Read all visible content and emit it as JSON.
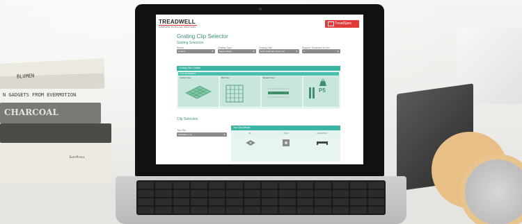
{
  "scene": {
    "book_spine_texts": [
      "BLUMEN",
      "N GADGETS FROM EVERMOTION",
      "CHARCOAL",
      "EverPress"
    ]
  },
  "app": {
    "logo": "TREADWELL",
    "tagline": "COMPLETE \"Fit & Forget\" SOLUTIONS",
    "badge": "TreadSpec",
    "page_title": "Grating Clip Selector",
    "grating_selection": {
      "title": "Grating Selection",
      "fields": [
        {
          "label": "Series",
          "value": "StrutLIT"
        },
        {
          "label": "Grating Type",
          "value": "Square Mesh"
        },
        {
          "label": "Grating Size",
          "value": "STR-1538 (38), 25mm Fill"
        },
        {
          "label": "Support Thickness in mm",
          "value": "3"
        }
      ]
    },
    "grating_size_details": {
      "title": "Grating Size Details",
      "product": "STR-38(38)38CS",
      "views": [
        "Isometric View",
        "Plan View",
        "Elevation View"
      ],
      "weight_label": "P5"
    },
    "clip_selection": {
      "title": "Clip Selection",
      "field_label": "Top Clip",
      "field_value": "Standard 3, 1b",
      "details_title": "Top Clip Details",
      "columns": [
        "3D",
        "PLAN",
        "ELEVATION"
      ]
    }
  }
}
